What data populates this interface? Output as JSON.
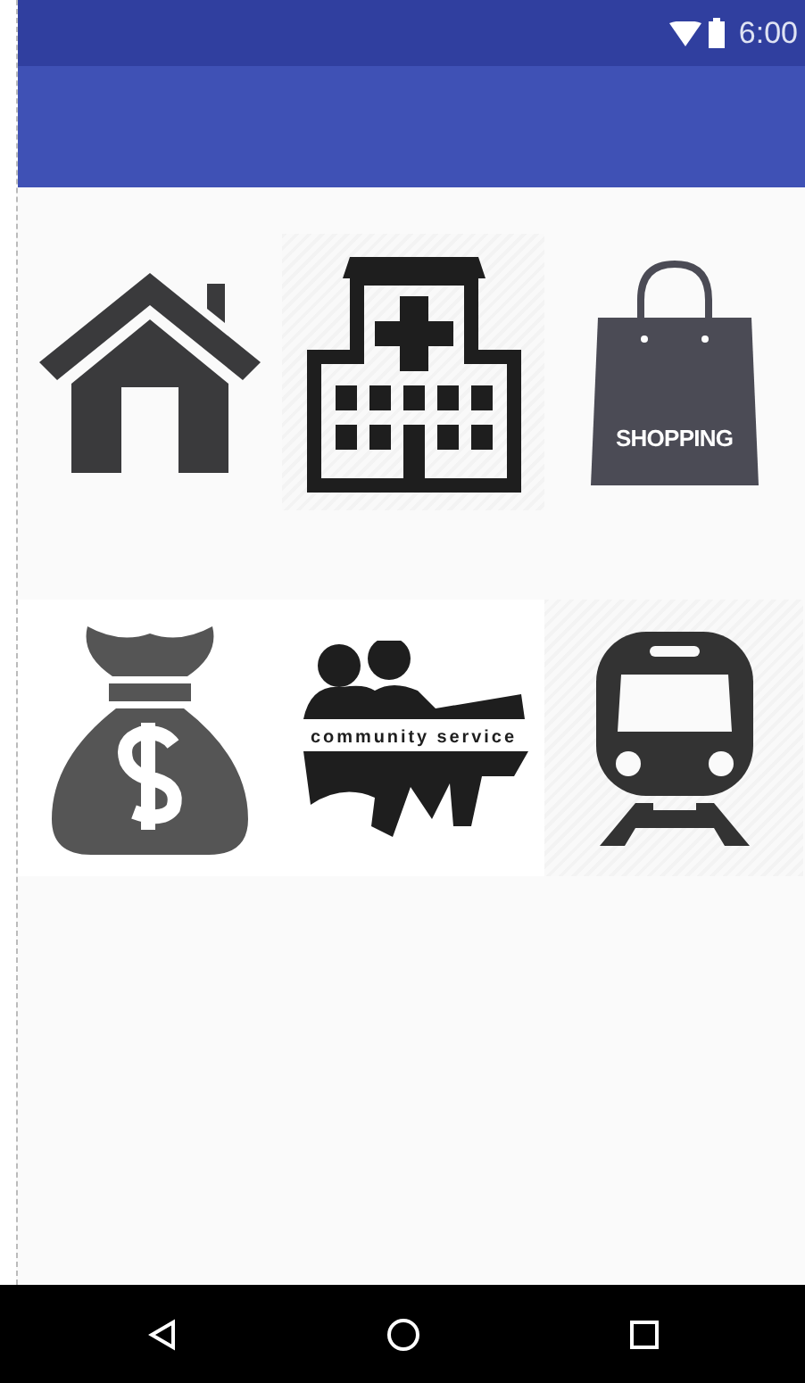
{
  "status_bar": {
    "time": "6:00"
  },
  "tiles": [
    {
      "kind": "house"
    },
    {
      "kind": "hospital"
    },
    {
      "kind": "bag",
      "label": "SHOPPING"
    },
    {
      "kind": "money"
    },
    {
      "kind": "community",
      "label": "community service"
    },
    {
      "kind": "train"
    }
  ],
  "nav_bar": {
    "buttons": [
      {
        "kind": "back"
      },
      {
        "kind": "home"
      },
      {
        "kind": "recents"
      }
    ]
  }
}
